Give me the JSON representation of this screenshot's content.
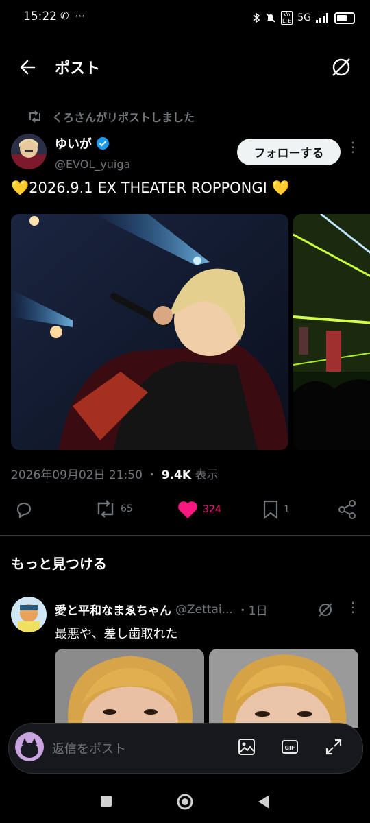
{
  "status_bar": {
    "time": "15:22",
    "left_icons": "✆ ⋯",
    "network": "5G"
  },
  "header": {
    "title": "ポスト"
  },
  "repost": {
    "text": "くろさんがリポストしました"
  },
  "author": {
    "name": "ゆいが",
    "handle": "@EVOL_yuiga",
    "follow_label": "フォローする"
  },
  "post": {
    "text": "💛2026.9.1 EX THEATER ROPPONGI 💛",
    "timestamp": "2026年09月02日 21:50",
    "separator": "・",
    "views": "9.4K",
    "views_label": "表示"
  },
  "actions": {
    "retweets": "65",
    "likes": "324",
    "bookmarks": "1"
  },
  "discover": {
    "title": "もっと見つける"
  },
  "recommended": {
    "name": "愛と平和なまゑちゃん",
    "handle": "@Zettai...",
    "time": "・1日",
    "text": "最悪や、差し歯取れた"
  },
  "reply": {
    "placeholder": "返信をポスト"
  },
  "colors": {
    "like": "#f91880",
    "verified": "#1d9bf0",
    "muted": "#71767b"
  }
}
